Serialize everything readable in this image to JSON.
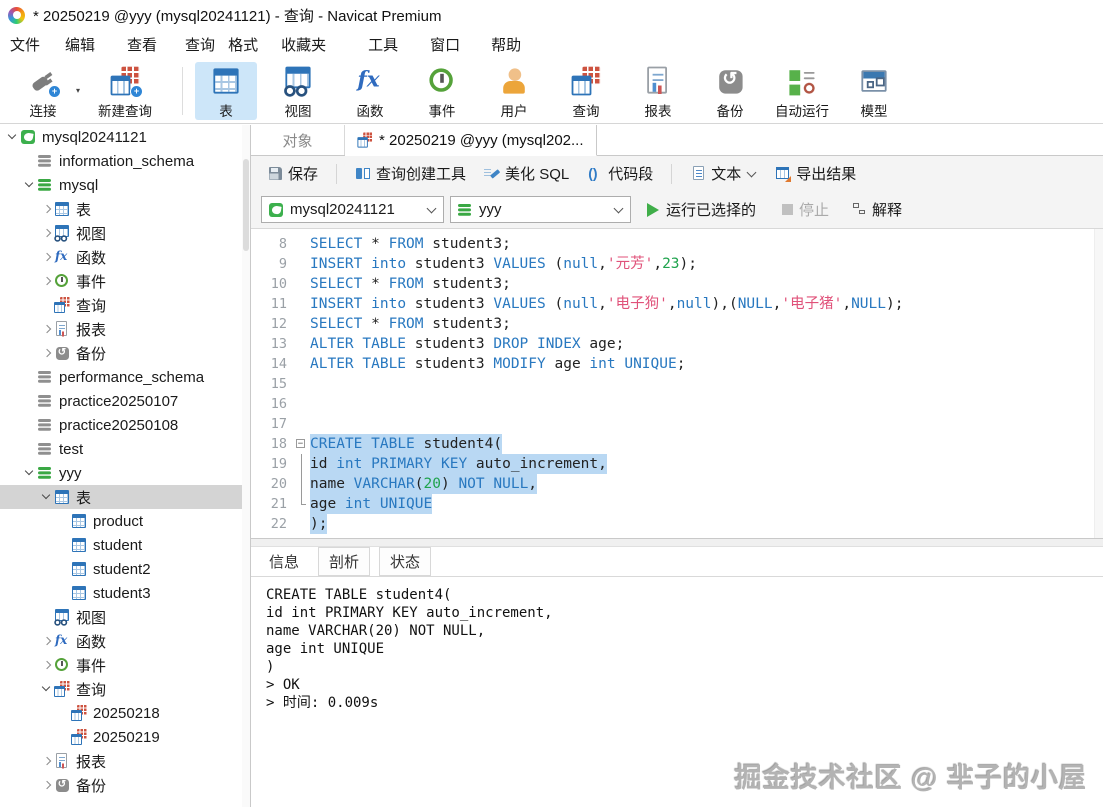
{
  "title_bar": {
    "title": "* 20250219 @yyy (mysql20241121) - 查询 - Navicat Premium"
  },
  "menu": {
    "items": [
      "文件",
      "编辑",
      "查看",
      "查询",
      "格式",
      "收藏夹",
      "工具",
      "窗口",
      "帮助"
    ]
  },
  "toolbar": {
    "items": [
      {
        "label": "连接",
        "icon": "connection-plug-icon",
        "cls": "ic-plug",
        "badge": true,
        "caret": true,
        "w": "w-conn"
      },
      {
        "label": "新建查询",
        "icon": "new-query-icon",
        "cls": "ic-query",
        "badge": true,
        "w": "w-newq"
      },
      {
        "sep": true
      },
      {
        "label": "表",
        "icon": "table-icon",
        "cls": "ic-table",
        "active": true
      },
      {
        "label": "视图",
        "icon": "view-icon",
        "cls": "ic-view"
      },
      {
        "label": "函数",
        "icon": "function-icon",
        "cls": "ic-fx"
      },
      {
        "label": "事件",
        "icon": "event-icon",
        "cls": "ic-clock"
      },
      {
        "label": "用户",
        "icon": "user-icon",
        "cls": "ic-user"
      },
      {
        "label": "查询",
        "icon": "query-icon",
        "cls": "ic-query"
      },
      {
        "label": "报表",
        "icon": "report-icon",
        "cls": "ic-report"
      },
      {
        "label": "备份",
        "icon": "backup-icon",
        "cls": "ic-backup"
      },
      {
        "label": "自动运行",
        "icon": "automation-icon",
        "cls": "ic-auto"
      },
      {
        "label": "模型",
        "icon": "model-icon",
        "cls": "ic-model"
      }
    ]
  },
  "sidebar": {
    "items": [
      {
        "label": "mysql20241121",
        "icon": "connection-icon",
        "cls": "ic-conn",
        "level": 0,
        "arrow": "down"
      },
      {
        "label": "information_schema",
        "icon": "database-gray-icon",
        "cls": "ic-db",
        "level": 1,
        "arrow": null
      },
      {
        "label": "mysql",
        "icon": "database-green-icon",
        "cls": "ic-db green",
        "level": 1,
        "arrow": "down"
      },
      {
        "label": "表",
        "icon": "tables-folder-icon",
        "cls": "ic-table",
        "level": 2,
        "arrow": "right"
      },
      {
        "label": "视图",
        "icon": "views-folder-icon",
        "cls": "ic-view",
        "level": 2,
        "arrow": "right"
      },
      {
        "label": "函数",
        "icon": "functions-folder-icon",
        "cls": "ic-fx",
        "level": 2,
        "arrow": "right"
      },
      {
        "label": "事件",
        "icon": "events-folder-icon",
        "cls": "ic-clock",
        "level": 2,
        "arrow": "right"
      },
      {
        "label": "查询",
        "icon": "queries-folder-icon",
        "cls": "ic-query",
        "level": 2,
        "arrow": null
      },
      {
        "label": "报表",
        "icon": "reports-folder-icon",
        "cls": "ic-report",
        "level": 2,
        "arrow": "right"
      },
      {
        "label": "备份",
        "icon": "backups-folder-icon",
        "cls": "ic-backup",
        "level": 2,
        "arrow": "right"
      },
      {
        "label": "performance_schema",
        "icon": "database-gray-icon",
        "cls": "ic-db",
        "level": 1,
        "arrow": null
      },
      {
        "label": "practice20250107",
        "icon": "database-gray-icon",
        "cls": "ic-db",
        "level": 1,
        "arrow": null
      },
      {
        "label": "practice20250108",
        "icon": "database-gray-icon",
        "cls": "ic-db",
        "level": 1,
        "arrow": null
      },
      {
        "label": "test",
        "icon": "database-gray-icon",
        "cls": "ic-db",
        "level": 1,
        "arrow": null
      },
      {
        "label": "yyy",
        "icon": "database-green-icon",
        "cls": "ic-db green",
        "level": 1,
        "arrow": "down"
      },
      {
        "label": "表",
        "icon": "tables-folder-icon",
        "cls": "ic-table",
        "level": 2,
        "arrow": "down",
        "selected": true
      },
      {
        "label": "product",
        "icon": "table-icon",
        "cls": "ic-table",
        "level": 3,
        "arrow": null
      },
      {
        "label": "student",
        "icon": "table-icon",
        "cls": "ic-table",
        "level": 3,
        "arrow": null
      },
      {
        "label": "student2",
        "icon": "table-icon",
        "cls": "ic-table",
        "level": 3,
        "arrow": null
      },
      {
        "label": "student3",
        "icon": "table-icon",
        "cls": "ic-table",
        "level": 3,
        "arrow": null
      },
      {
        "label": "视图",
        "icon": "views-folder-icon",
        "cls": "ic-view",
        "level": 2,
        "arrow": null
      },
      {
        "label": "函数",
        "icon": "functions-folder-icon",
        "cls": "ic-fx",
        "level": 2,
        "arrow": "right"
      },
      {
        "label": "事件",
        "icon": "events-folder-icon",
        "cls": "ic-clock",
        "level": 2,
        "arrow": "right"
      },
      {
        "label": "查询",
        "icon": "queries-folder-icon",
        "cls": "ic-query",
        "level": 2,
        "arrow": "down"
      },
      {
        "label": "20250218",
        "icon": "query-file-icon",
        "cls": "ic-query",
        "level": 3,
        "arrow": null
      },
      {
        "label": "20250219",
        "icon": "query-file-icon",
        "cls": "ic-query",
        "level": 3,
        "arrow": null
      },
      {
        "label": "报表",
        "icon": "reports-folder-icon",
        "cls": "ic-report",
        "level": 2,
        "arrow": "right"
      },
      {
        "label": "备份",
        "icon": "backups-folder-icon",
        "cls": "ic-backup",
        "level": 2,
        "arrow": "right"
      }
    ]
  },
  "tabs": {
    "objects_label": "对象",
    "active_label": "* 20250219 @yyy (mysql202..."
  },
  "query_toolbar": {
    "save": "保存",
    "builder": "查询创建工具",
    "beautify": "美化 SQL",
    "snippet": "代码段",
    "text": "文本",
    "export": "导出结果"
  },
  "run_bar": {
    "connection": "mysql20241121",
    "database": "yyy",
    "run": "运行已选择的",
    "stop": "停止",
    "explain": "解释"
  },
  "editor": {
    "lines": [
      {
        "n": "8",
        "fold": "",
        "sel": false,
        "seg": [
          [
            "SELECT",
            "k"
          ],
          [
            " * ",
            "p"
          ],
          [
            "FROM",
            "k"
          ],
          [
            " student3;",
            "p"
          ]
        ]
      },
      {
        "n": "9",
        "fold": "",
        "sel": false,
        "seg": [
          [
            "INSERT",
            "k"
          ],
          [
            " ",
            "p"
          ],
          [
            "into",
            "k"
          ],
          [
            " student3 ",
            "p"
          ],
          [
            "VALUES",
            "k"
          ],
          [
            " (",
            "p"
          ],
          [
            "null",
            "k"
          ],
          [
            ",",
            "p"
          ],
          [
            "'元芳'",
            "s"
          ],
          [
            ",",
            "p"
          ],
          [
            "23",
            "n"
          ],
          [
            ");",
            "p"
          ]
        ]
      },
      {
        "n": "10",
        "fold": "",
        "sel": false,
        "seg": [
          [
            "SELECT",
            "k"
          ],
          [
            " * ",
            "p"
          ],
          [
            "FROM",
            "k"
          ],
          [
            " student3;",
            "p"
          ]
        ]
      },
      {
        "n": "11",
        "fold": "",
        "sel": false,
        "seg": [
          [
            "INSERT",
            "k"
          ],
          [
            " ",
            "p"
          ],
          [
            "into",
            "k"
          ],
          [
            " student3 ",
            "p"
          ],
          [
            "VALUES",
            "k"
          ],
          [
            " (",
            "p"
          ],
          [
            "null",
            "k"
          ],
          [
            ",",
            "p"
          ],
          [
            "'电子狗'",
            "s"
          ],
          [
            ",",
            "p"
          ],
          [
            "null",
            "k"
          ],
          [
            "),(",
            "p"
          ],
          [
            "NULL",
            "k"
          ],
          [
            ",",
            "p"
          ],
          [
            "'电子猪'",
            "s"
          ],
          [
            ",",
            "p"
          ],
          [
            "NULL",
            "k"
          ],
          [
            ");",
            "p"
          ]
        ]
      },
      {
        "n": "12",
        "fold": "",
        "sel": false,
        "seg": [
          [
            "SELECT",
            "k"
          ],
          [
            " * ",
            "p"
          ],
          [
            "FROM",
            "k"
          ],
          [
            " student3;",
            "p"
          ]
        ]
      },
      {
        "n": "13",
        "fold": "",
        "sel": false,
        "seg": [
          [
            "ALTER",
            "k"
          ],
          [
            " ",
            "p"
          ],
          [
            "TABLE",
            "k"
          ],
          [
            " student3 ",
            "p"
          ],
          [
            "DROP",
            "k"
          ],
          [
            " ",
            "p"
          ],
          [
            "INDEX",
            "k"
          ],
          [
            " age;",
            "p"
          ]
        ]
      },
      {
        "n": "14",
        "fold": "",
        "sel": false,
        "seg": [
          [
            "ALTER",
            "k"
          ],
          [
            " ",
            "p"
          ],
          [
            "TABLE",
            "k"
          ],
          [
            " student3 ",
            "p"
          ],
          [
            "MODIFY",
            "k"
          ],
          [
            " age ",
            "p"
          ],
          [
            "int",
            "k"
          ],
          [
            " ",
            "p"
          ],
          [
            "UNIQUE",
            "k"
          ],
          [
            ";",
            "p"
          ]
        ]
      },
      {
        "n": "15",
        "fold": "",
        "sel": false,
        "seg": []
      },
      {
        "n": "16",
        "fold": "",
        "sel": false,
        "seg": []
      },
      {
        "n": "17",
        "fold": "",
        "sel": false,
        "seg": []
      },
      {
        "n": "18",
        "fold": "start",
        "sel": true,
        "seg": [
          [
            "CREATE",
            "k"
          ],
          [
            " ",
            "p"
          ],
          [
            "TABLE",
            "k"
          ],
          [
            " student4(",
            "p"
          ]
        ]
      },
      {
        "n": "19",
        "fold": "mid",
        "sel": true,
        "seg": [
          [
            "id ",
            "p"
          ],
          [
            "int",
            "k"
          ],
          [
            " ",
            "p"
          ],
          [
            "PRIMARY",
            "k"
          ],
          [
            " ",
            "p"
          ],
          [
            "KEY",
            "k"
          ],
          [
            " auto_increment,",
            "p"
          ]
        ]
      },
      {
        "n": "20",
        "fold": "mid",
        "sel": true,
        "seg": [
          [
            "name ",
            "p"
          ],
          [
            "VARCHAR",
            "k"
          ],
          [
            "(",
            "p"
          ],
          [
            "20",
            "n"
          ],
          [
            ") ",
            "p"
          ],
          [
            "NOT",
            "k"
          ],
          [
            " ",
            "p"
          ],
          [
            "NULL",
            "k"
          ],
          [
            ",",
            "p"
          ]
        ]
      },
      {
        "n": "21",
        "fold": "end",
        "sel": true,
        "seg": [
          [
            "age ",
            "p"
          ],
          [
            "int",
            "k"
          ],
          [
            " ",
            "p"
          ],
          [
            "UNIQUE",
            "k"
          ]
        ]
      },
      {
        "n": "22",
        "fold": "",
        "sel": true,
        "seg": [
          [
            ");",
            "p"
          ]
        ]
      }
    ]
  },
  "result": {
    "tabs": [
      "信息",
      "剖析",
      "状态"
    ],
    "active_tab": "信息",
    "output_lines": [
      "CREATE TABLE student4(",
      "id int PRIMARY KEY auto_increment,",
      "name VARCHAR(20) NOT NULL,",
      "age int UNIQUE",
      ")",
      "> OK",
      "> 时间: 0.009s"
    ]
  },
  "watermark": "掘金技术社区 @ 芈子的小屋",
  "colors": {
    "keyword": "#2878c0",
    "string": "#e0527a",
    "number": "#1fa34d",
    "selection": "#b9d8f3",
    "toolbar_active_bg": "#cde6f9",
    "run_green": "#3fae49",
    "accent_blue": "#2e74b8"
  }
}
